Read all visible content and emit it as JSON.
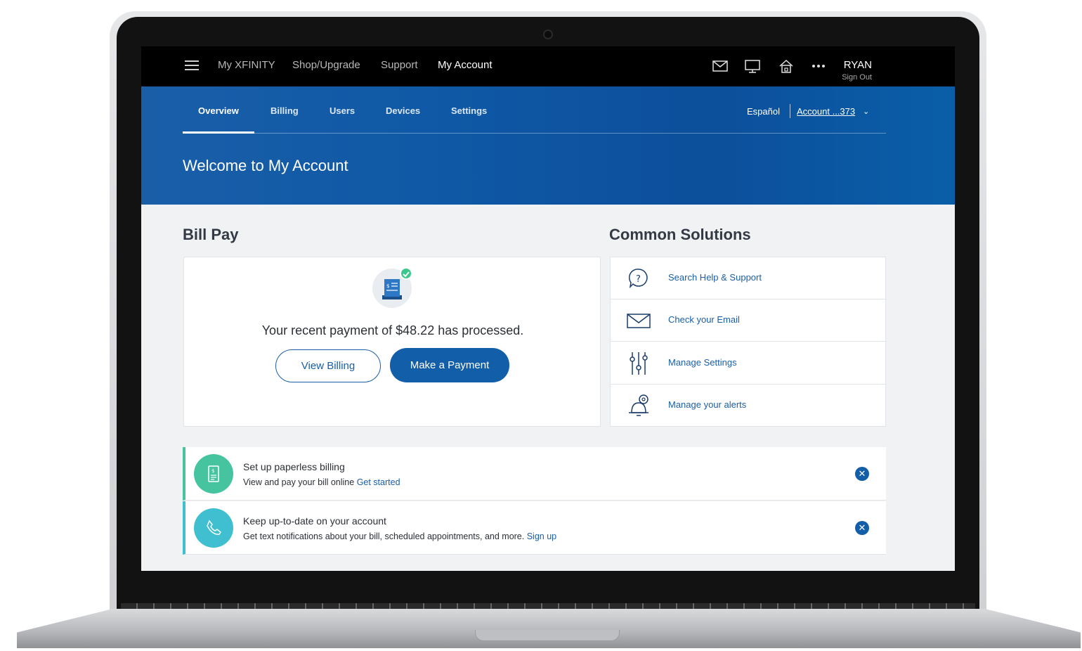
{
  "topnav": {
    "links": [
      "My XFINITY",
      "Shop/Upgrade",
      "Support",
      "My Account"
    ],
    "active": "My Account",
    "icons": [
      "mail-icon",
      "tv-icon",
      "home-icon",
      "more-icon"
    ],
    "user_name": "RYAN",
    "sign_out": "Sign Out"
  },
  "subnav": {
    "tabs": [
      "Overview",
      "Billing",
      "Users",
      "Devices",
      "Settings"
    ],
    "active": "Overview",
    "language": "Español",
    "account": "Account ...373"
  },
  "header": {
    "title": "Welcome to My Account"
  },
  "bill_pay": {
    "title": "Bill Pay",
    "message": "Your recent payment of $48.22 has processed.",
    "view_billing": "View Billing",
    "make_payment": "Make a Payment"
  },
  "common_solutions": {
    "title": "Common Solutions",
    "items": [
      {
        "label": "Search Help & Support",
        "icon": "help-bubble-icon"
      },
      {
        "label": "Check your Email",
        "icon": "envelope-icon"
      },
      {
        "label": "Manage Settings",
        "icon": "sliders-icon"
      },
      {
        "label": "Manage your alerts",
        "icon": "alert-bell-icon"
      }
    ]
  },
  "notifications": [
    {
      "title": "Set up paperless billing",
      "body": "View and pay your bill online",
      "link": "Get started",
      "icon": "paperless-bill-icon",
      "color": "#46c4a0"
    },
    {
      "title": "Keep up-to-date on your account",
      "body": "Get text notifications about your bill, scheduled appointments, and more.",
      "link": "Sign up",
      "icon": "phone-icon",
      "color": "#3fbfcf"
    }
  ],
  "colors": {
    "brand_blue": "#135ea8",
    "top_bar": "#000000",
    "success_green": "#3cc88c"
  }
}
